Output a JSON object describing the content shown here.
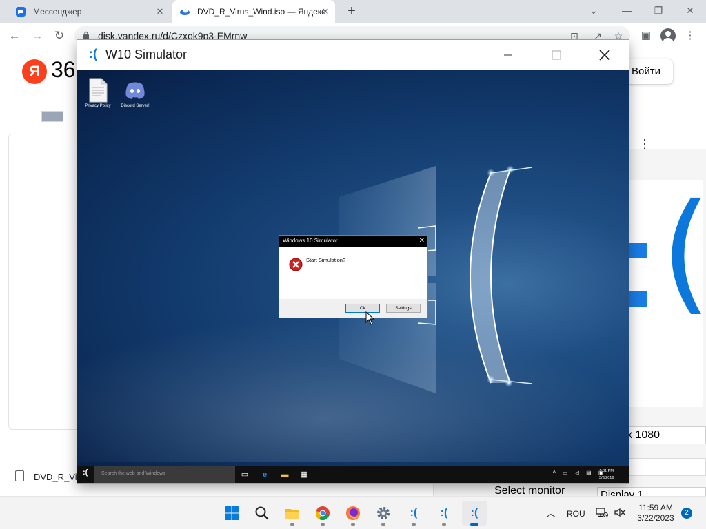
{
  "browser": {
    "tabs": [
      {
        "title": "Мессенджер"
      },
      {
        "title": "DVD_R_Virus_Wind.iso — Яндекс"
      }
    ],
    "url": "disk.yandex.ru/d/Czxok9p3-EMrnw"
  },
  "webpage": {
    "logo_letter": "Я",
    "logo_number": "36",
    "login_label": "Войти",
    "resolution_value": "x 1080",
    "select_monitor_label": "Select monitor",
    "display_value": "Display 1",
    "download_file": "DVD_R_Vir"
  },
  "simulator": {
    "icon": ":(",
    "title": "W10 Simulator",
    "desktop_icons": [
      {
        "label": "Privacy Policy",
        "icon": "document-icon"
      },
      {
        "label": "Discord Server!",
        "icon": "discord-icon"
      }
    ],
    "dialog": {
      "title": "Windows 10 Simulator",
      "message": "Start Simulation?",
      "ok_label": "Ok",
      "settings_label": "Settings"
    },
    "taskbar": {
      "start": ":(",
      "search_placeholder": "Search the web and Windows",
      "time": "5:01 PM",
      "date": "3/3/2016"
    }
  },
  "os_taskbar": {
    "apps": [
      {
        "name": "start",
        "icon": "windows-logo-icon"
      },
      {
        "name": "search",
        "icon": "search-icon"
      },
      {
        "name": "file-explorer",
        "icon": "folder-icon"
      },
      {
        "name": "chrome",
        "icon": "chrome-icon"
      },
      {
        "name": "firefox",
        "icon": "firefox-icon"
      },
      {
        "name": "settings",
        "icon": "gear-icon"
      },
      {
        "name": "w10-simulator-1",
        "label": ":("
      },
      {
        "name": "w10-simulator-2",
        "label": ":("
      },
      {
        "name": "w10-simulator-3",
        "label": ":("
      }
    ],
    "language": "ROU",
    "time": "11:59 AM",
    "date": "3/22/2023",
    "notification_count": "2"
  },
  "colors": {
    "accent": "#0067c0",
    "yandex_red": "#fc3f1d",
    "desktop_blue": "#123a6c"
  }
}
